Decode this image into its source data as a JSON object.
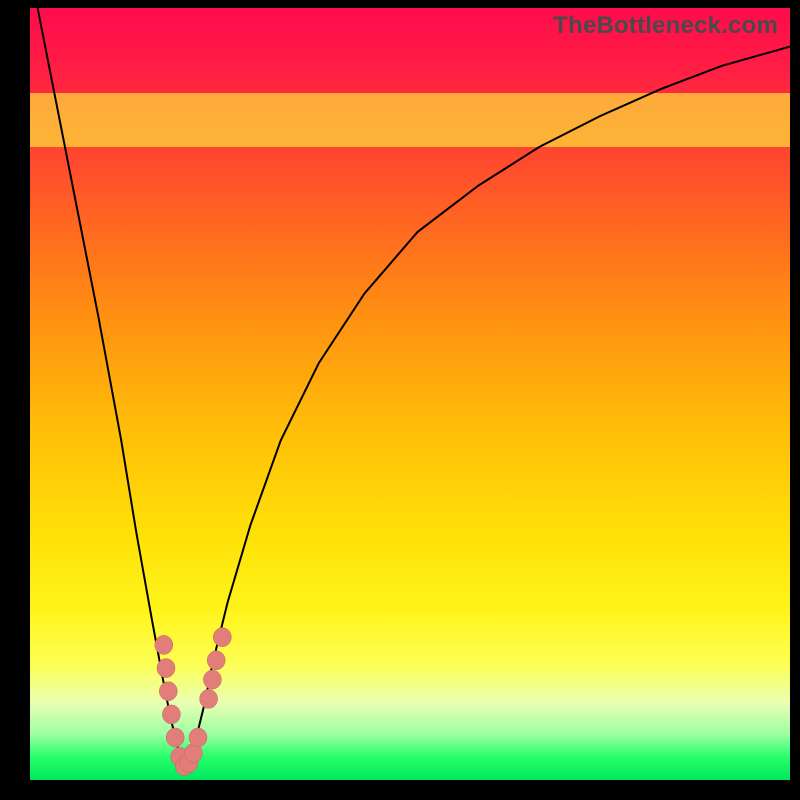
{
  "watermark": "TheBottleneck.com",
  "colors": {
    "curve_stroke": "#000000",
    "marker_fill": "#e17e7a",
    "marker_stroke": "#c56560"
  },
  "chart_data": {
    "type": "line",
    "title": "",
    "xlabel": "",
    "ylabel": "",
    "xlim": [
      0,
      100
    ],
    "ylim": [
      0,
      100
    ],
    "series": [
      {
        "name": "bottleneck-curve",
        "x": [
          0,
          3,
          6,
          9,
          12,
          14,
          16,
          17.5,
          18.5,
          19.5,
          20,
          20.5,
          21,
          22,
          23,
          24,
          26,
          29,
          33,
          38,
          44,
          51,
          59,
          67,
          75,
          83,
          91,
          100
        ],
        "y": [
          105,
          90,
          75,
          60,
          44,
          32,
          21,
          13,
          8,
          4,
          2,
          2,
          3,
          6,
          10,
          15,
          23,
          33,
          44,
          54,
          63,
          71,
          77,
          82,
          86,
          89.5,
          92.5,
          95
        ]
      }
    ],
    "markers": {
      "name": "data-points",
      "points": [
        {
          "x": 17.6,
          "y": 17.5
        },
        {
          "x": 17.9,
          "y": 14.5
        },
        {
          "x": 18.2,
          "y": 11.5
        },
        {
          "x": 18.6,
          "y": 8.5
        },
        {
          "x": 19.1,
          "y": 5.5
        },
        {
          "x": 19.7,
          "y": 3.0
        },
        {
          "x": 20.3,
          "y": 1.8
        },
        {
          "x": 20.9,
          "y": 2.2
        },
        {
          "x": 21.5,
          "y": 3.5
        },
        {
          "x": 22.1,
          "y": 5.5
        },
        {
          "x": 23.5,
          "y": 10.5
        },
        {
          "x": 24.0,
          "y": 13.0
        },
        {
          "x": 24.5,
          "y": 15.5
        },
        {
          "x": 25.3,
          "y": 18.5
        }
      ]
    },
    "bands": [
      {
        "name": "pale-yellow-band",
        "y0": 82,
        "y1": 89
      }
    ]
  }
}
